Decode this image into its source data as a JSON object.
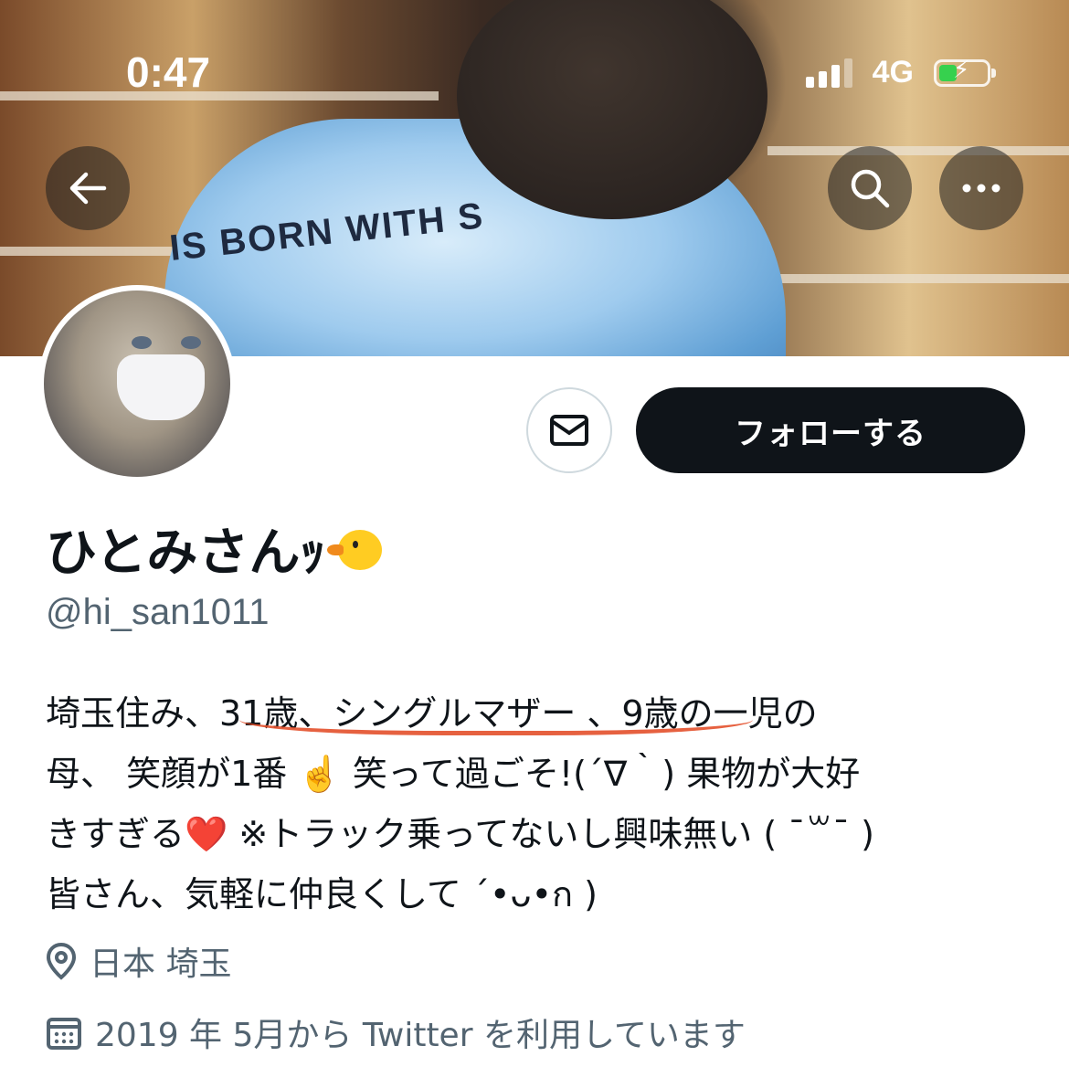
{
  "status_bar": {
    "time": "0:47",
    "network": "4G",
    "battery_charging": true
  },
  "header": {
    "back_icon": "arrow-left-icon",
    "search_icon": "search-icon",
    "more_icon": "more-horizontal-icon"
  },
  "profile": {
    "display_name": "ひとみさんｯ",
    "display_name_emoji": "chick-emoji",
    "handle": "@hi_san1011",
    "follow_label": "フォローする",
    "message_icon": "envelope-icon",
    "bio_lines": [
      "埼玉住み、31歳、シングルマザー 、9歳の一児の",
      "母、 笑顔が1番 ☝️ 笑って過ごそ!(´∇｀) 果物が大好",
      "きすぎる❤️ ※トラック乗ってないし興味無い ( ˉ꒳ˉ )",
      "皆さん、気軽に仲良くして ´•ᴗ•ก )"
    ],
    "location": "日本 埼玉",
    "location_icon": "location-pin-icon",
    "joined": "2019 年 5月から Twitter を利用しています",
    "joined_icon": "calendar-icon"
  },
  "colors": {
    "follow_button_bg": "#0f1419",
    "secondary_text": "#536471",
    "annotation_underline": "#e4502c",
    "battery_fill": "#36d14e"
  },
  "banner_text": "IS BORN WITH S"
}
